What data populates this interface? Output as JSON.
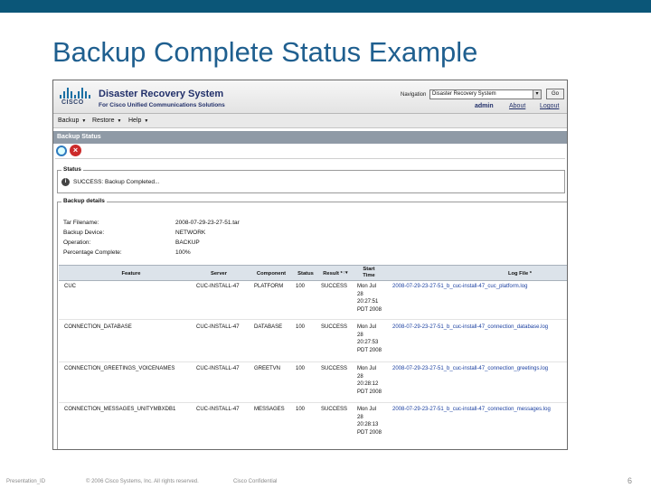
{
  "slide": {
    "title": "Backup Complete Status Example",
    "footer_left": "Presentation_ID",
    "footer_copyright": "© 2006 Cisco Systems, Inc. All rights reserved.",
    "footer_confidential": "Cisco Confidential",
    "page_number": "6",
    "accent_color": "#1f5f8f",
    "topbar_color": "#0b5678"
  },
  "app": {
    "logo_text": "CISCO",
    "title": "Disaster Recovery System",
    "subtitle": "For Cisco Unified Communications Solutions",
    "navigation_label": "Navigation",
    "navigation_selected": "Disaster Recovery System",
    "go_label": "Go",
    "user": "admin",
    "about_link": "About",
    "logout_link": "Logout"
  },
  "menu": {
    "items": [
      {
        "label": "Backup"
      },
      {
        "label": "Restore"
      },
      {
        "label": "Help"
      }
    ]
  },
  "page": {
    "header": "Backup Status",
    "toolbar": {
      "refresh_icon": "refresh-icon",
      "cancel_icon": "cancel-icon"
    }
  },
  "status": {
    "legend": "Status",
    "icon": "info-icon",
    "message": "SUCCESS: Backup Completed..."
  },
  "backup_details": {
    "legend": "Backup details",
    "fields": [
      {
        "label": "Tar Filename:",
        "value": "2008-07-29-23-27-51.tar"
      },
      {
        "label": "Backup Device:",
        "value": "NETWORK"
      },
      {
        "label": "Operation:",
        "value": "BACKUP"
      },
      {
        "label": "Percentage Complete:",
        "value": "100%"
      }
    ]
  },
  "table": {
    "columns": [
      "Feature",
      "Server",
      "Component",
      "Status",
      "Result *",
      "Start Time",
      "Log File *"
    ],
    "sort_indicator": "↑▾",
    "rows": [
      {
        "feature": "CUC",
        "server": "CUC-INSTALL-47",
        "component": "PLATFORM",
        "status": "100",
        "result": "SUCCESS",
        "start_time": "Mon Jul 28 20:27:51 PDT 2008",
        "log_file": "2008-07-29-23-27-51_b_cuc-install-47_cuc_platform.log"
      },
      {
        "feature": "CONNECTION_DATABASE",
        "server": "CUC-INSTALL-47",
        "component": "DATABASE",
        "status": "100",
        "result": "SUCCESS",
        "start_time": "Mon Jul 28 20:27:53 PDT 2008",
        "log_file": "2008-07-29-23-27-51_b_cuc-install-47_connection_database.log"
      },
      {
        "feature": "CONNECTION_GREETINGS_VOICENAMES",
        "server": "CUC-INSTALL-47",
        "component": "GREETVN",
        "status": "100",
        "result": "SUCCESS",
        "start_time": "Mon Jul 28 20:28:12 PDT 2008",
        "log_file": "2008-07-29-23-27-51_b_cuc-install-47_connection_greetings.log"
      },
      {
        "feature": "CONNECTION_MESSAGES_UNITYMBXDB1",
        "server": "CUC-INSTALL-47",
        "component": "MESSAGES",
        "status": "100",
        "result": "SUCCESS",
        "start_time": "Mon Jul 28 20:28:13 PDT 2008",
        "log_file": "2008-07-29-23-27-51_b_cuc-install-47_connection_messages.log"
      }
    ]
  }
}
